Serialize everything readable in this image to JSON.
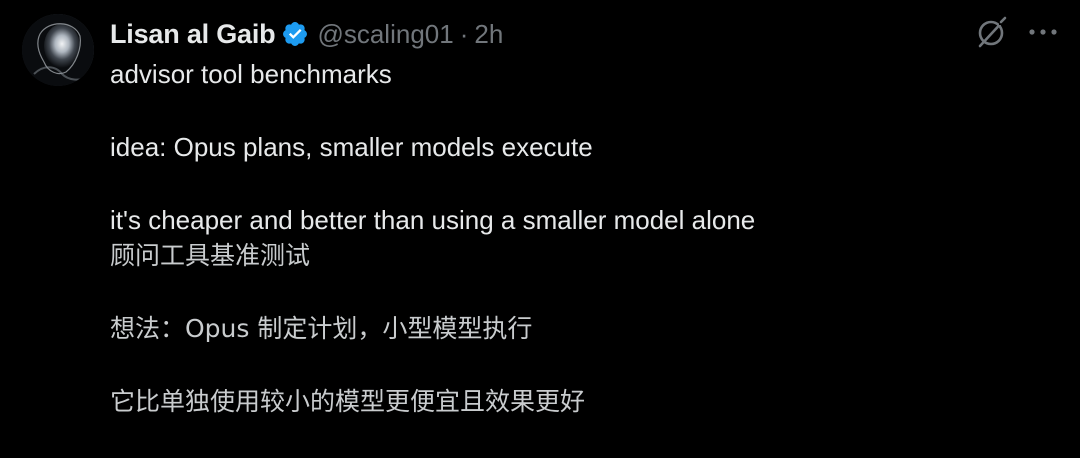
{
  "tweet": {
    "author_name": "Lisan al Gaib",
    "handle": "@scaling01",
    "separator": "·",
    "time": "2h",
    "lines": [
      "advisor tool benchmarks",
      "idea: Opus plans, smaller models execute",
      "it's cheaper and better than using a smaller model alone"
    ],
    "translation_lines": [
      "顾问工具基准测试",
      "想法：Opus 制定计划，小型模型执行",
      "它比单独使用较小的模型更便宜且效果更好"
    ]
  },
  "icons": {
    "verified": "verified-badge-icon",
    "grok": "grok-icon",
    "more": "more-options-icon"
  },
  "colors": {
    "background": "#000000",
    "text_primary": "#e7e9ea",
    "text_secondary": "#71767b",
    "verified_blue": "#1d9bf0"
  }
}
